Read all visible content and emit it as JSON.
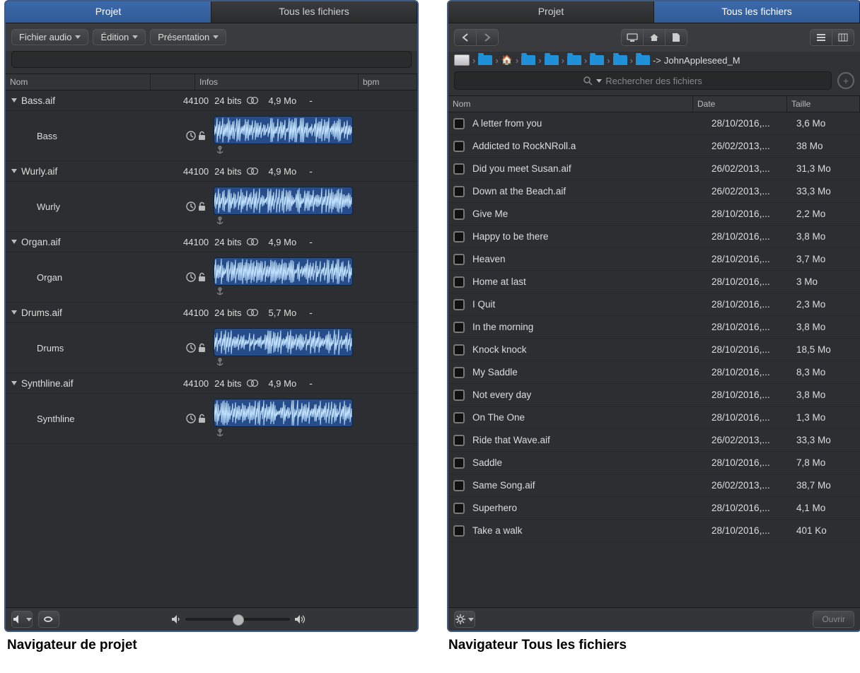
{
  "captions": {
    "left": "Navigateur de projet",
    "right": "Navigateur Tous les fichiers"
  },
  "project": {
    "tabs": {
      "project": "Projet",
      "all": "Tous les fichiers"
    },
    "menus": {
      "audio": "Fichier audio",
      "edit": "Édition",
      "view": "Présentation"
    },
    "columns": {
      "name": "Nom",
      "info": "Infos",
      "bpm": "bpm"
    },
    "items": [
      {
        "file": "Bass.aif",
        "region": "Bass",
        "rate": "44100",
        "bits": "24 bits",
        "size": "4,9 Mo",
        "bpm": "-"
      },
      {
        "file": "Wurly.aif",
        "region": "Wurly",
        "rate": "44100",
        "bits": "24 bits",
        "size": "4,9 Mo",
        "bpm": "-"
      },
      {
        "file": "Organ.aif",
        "region": "Organ",
        "rate": "44100",
        "bits": "24 bits",
        "size": "4,9 Mo",
        "bpm": "-"
      },
      {
        "file": "Drums.aif",
        "region": "Drums",
        "rate": "44100",
        "bits": "24 bits",
        "size": "5,7 Mo",
        "bpm": "-"
      },
      {
        "file": "Synthline.aif",
        "region": "Synthline",
        "rate": "44100",
        "bits": "24 bits",
        "size": "4,9 Mo",
        "bpm": "-"
      }
    ],
    "slider_pos": 0.5
  },
  "files": {
    "tabs": {
      "project": "Projet",
      "all": "Tous les fichiers"
    },
    "breadcrumb_tail": "JohnAppleseed_M",
    "breadcrumb_arrow": "->",
    "search_placeholder": "Rechercher des fichiers",
    "columns": {
      "name": "Nom",
      "date": "Date",
      "size": "Taille"
    },
    "rows": [
      {
        "name": "A letter from you",
        "date": "28/10/2016,...",
        "size": "3,6 Mo"
      },
      {
        "name": "Addicted to RockNRoll.a",
        "date": "26/02/2013,...",
        "size": "38 Mo"
      },
      {
        "name": "Did you meet Susan.aif",
        "date": "26/02/2013,...",
        "size": "31,3 Mo"
      },
      {
        "name": "Down at the Beach.aif",
        "date": "26/02/2013,...",
        "size": "33,3 Mo"
      },
      {
        "name": "Give Me",
        "date": "28/10/2016,...",
        "size": "2,2 Mo"
      },
      {
        "name": "Happy to be there",
        "date": "28/10/2016,...",
        "size": "3,8 Mo"
      },
      {
        "name": "Heaven",
        "date": "28/10/2016,...",
        "size": "3,7 Mo"
      },
      {
        "name": "Home at last",
        "date": "28/10/2016,...",
        "size": "3 Mo"
      },
      {
        "name": "I Quit",
        "date": "28/10/2016,...",
        "size": "2,3 Mo"
      },
      {
        "name": "In the morning",
        "date": "28/10/2016,...",
        "size": "3,8 Mo"
      },
      {
        "name": "Knock knock",
        "date": "28/10/2016,...",
        "size": "18,5 Mo"
      },
      {
        "name": "My Saddle",
        "date": "28/10/2016,...",
        "size": "8,3 Mo"
      },
      {
        "name": "Not every day",
        "date": "28/10/2016,...",
        "size": "3,8 Mo"
      },
      {
        "name": "On The One",
        "date": "28/10/2016,...",
        "size": "1,3 Mo"
      },
      {
        "name": "Ride that Wave.aif",
        "date": "26/02/2013,...",
        "size": "33,3 Mo"
      },
      {
        "name": "Saddle",
        "date": "28/10/2016,...",
        "size": "7,8 Mo"
      },
      {
        "name": "Same Song.aif",
        "date": "26/02/2013,...",
        "size": "38,7 Mo"
      },
      {
        "name": "Superhero",
        "date": "28/10/2016,...",
        "size": "4,1 Mo"
      },
      {
        "name": "Take a walk",
        "date": "28/10/2016,...",
        "size": "401 Ko"
      }
    ],
    "open": "Ouvrir"
  }
}
